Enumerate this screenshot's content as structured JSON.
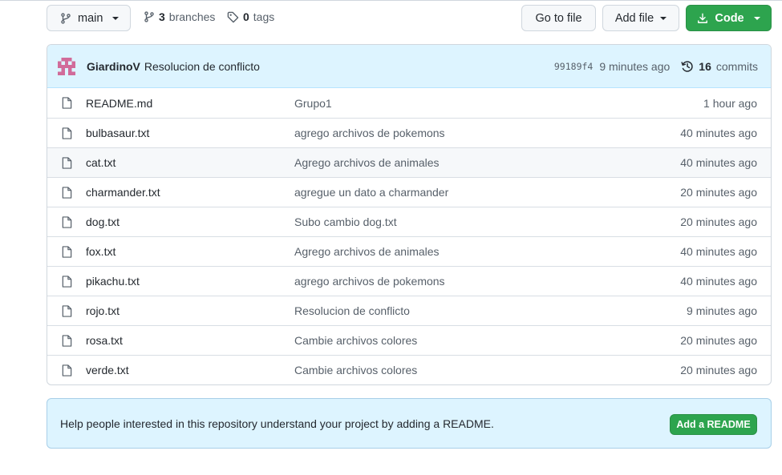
{
  "toolbar": {
    "branch": "main",
    "branches_count": "3",
    "branches_label": "branches",
    "tags_count": "0",
    "tags_label": "tags",
    "go_to_file": "Go to file",
    "add_file": "Add file",
    "code": "Code"
  },
  "latest_commit": {
    "author": "GiardinoV",
    "message": "Resolucion de conflicto",
    "sha": "99189f4",
    "time": "9 minutes ago",
    "commits_count": "16",
    "commits_label": "commits"
  },
  "files": [
    {
      "name": "README.md",
      "message": "Grupo1",
      "time": "1 hour ago"
    },
    {
      "name": "bulbasaur.txt",
      "message": "agrego archivos de pokemons",
      "time": "40 minutes ago"
    },
    {
      "name": "cat.txt",
      "message": "Agrego archivos de animales",
      "time": "40 minutes ago"
    },
    {
      "name": "charmander.txt",
      "message": "agregue un dato a charmander",
      "time": "20 minutes ago"
    },
    {
      "name": "dog.txt",
      "message": "Subo cambio dog.txt",
      "time": "20 minutes ago"
    },
    {
      "name": "fox.txt",
      "message": "Agrego archivos de animales",
      "time": "40 minutes ago"
    },
    {
      "name": "pikachu.txt",
      "message": "agrego archivos de pokemons",
      "time": "40 minutes ago"
    },
    {
      "name": "rojo.txt",
      "message": "Resolucion de conflicto",
      "time": "9 minutes ago"
    },
    {
      "name": "rosa.txt",
      "message": "Cambie archivos colores",
      "time": "20 minutes ago"
    },
    {
      "name": "verde.txt",
      "message": "Cambie archivos colores",
      "time": "20 minutes ago"
    }
  ],
  "readme_banner": {
    "text": "Help people interested in this repository understand your project by adding a README.",
    "button": "Add a README"
  },
  "colors": {
    "primary_green": "#2da44e",
    "banner_blue": "#ddf4ff",
    "border": "#d0d7de",
    "muted_text": "#57606a"
  },
  "icons": {
    "branch": "git-branch-icon",
    "tag": "tag-icon",
    "download": "download-icon",
    "history": "history-icon",
    "file": "file-icon"
  }
}
